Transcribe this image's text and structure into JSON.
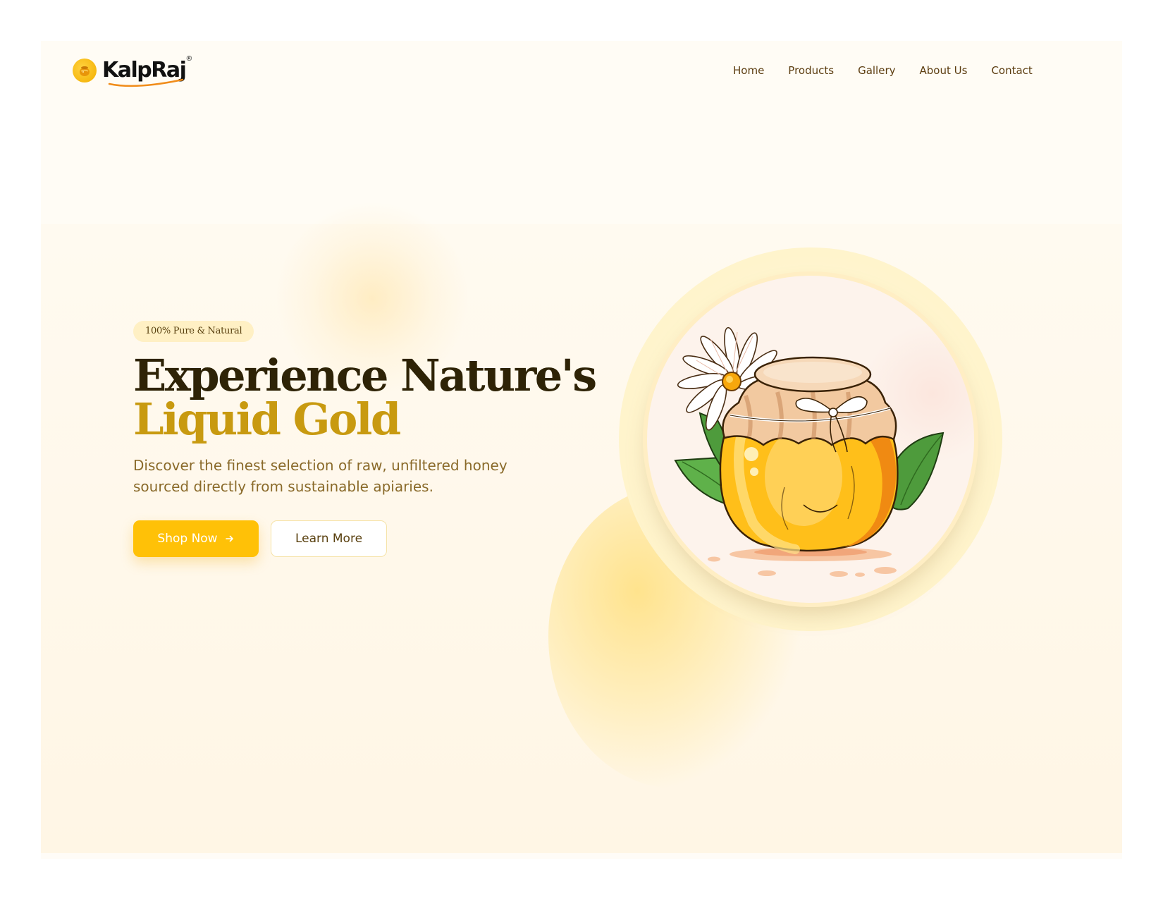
{
  "brand": {
    "name": "KalpRaj",
    "registered_mark": "®",
    "logo_icon": "honey-pot-icon"
  },
  "nav": {
    "links": [
      "Home",
      "Products",
      "Gallery",
      "About Us",
      "Contact"
    ]
  },
  "hero": {
    "badge": "100% Pure & Natural",
    "headline_line1": "Experience Nature's",
    "headline_line2": "Liquid Gold",
    "description": "Discover the finest selection of raw, unfiltered honey sourced directly from sustainable apiaries.",
    "primary_button": {
      "label": "Shop Now",
      "icon": "arrow-right-icon"
    },
    "secondary_button": {
      "label": "Learn More"
    },
    "illustration": "honey-jar-with-daisy-illustration"
  },
  "colors": {
    "accent": "#ffc107",
    "heading_dark": "#2e2306",
    "heading_gold": "#c89a10",
    "body_text": "#8a6a2a",
    "nav_text": "#5c3d10",
    "page_background": "#fffcf5"
  }
}
